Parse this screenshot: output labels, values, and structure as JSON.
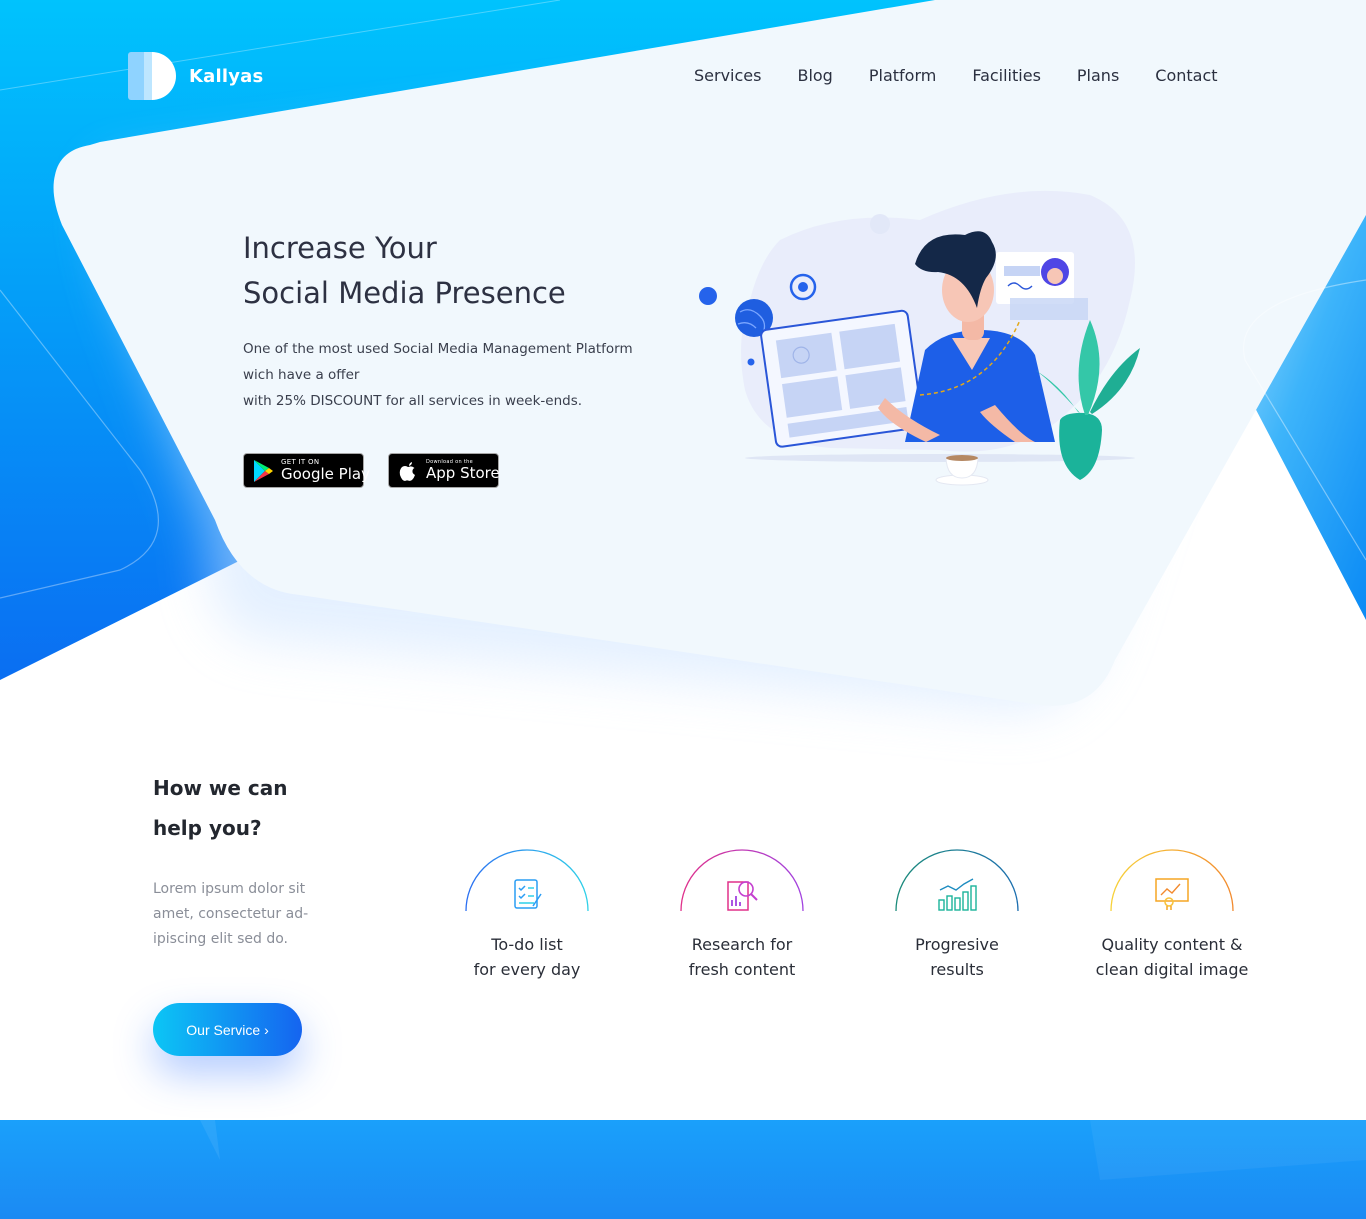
{
  "brand": {
    "name": "Kallyas",
    "logo_icon": "half-circle-logo-icon"
  },
  "nav": {
    "items": [
      "Services",
      "Blog",
      "Platform",
      "Facilities",
      "Plans",
      "Contact"
    ]
  },
  "hero": {
    "title_line1": "Increase Your",
    "title_line2": "Social Media Presence",
    "desc_line1": "One of the most used Social Media Management Platform",
    "desc_line2": "wich have a offer",
    "desc_line3": "with 25% DISCOUNT for all services in week-ends.",
    "google_play": {
      "small": "GET IT ON",
      "big": "Google Play",
      "icon": "google-play-icon"
    },
    "app_store": {
      "small": "Download on the",
      "big": "App Store",
      "icon": "apple-icon"
    }
  },
  "help": {
    "title_line1": "How we can",
    "title_line2": "help you?",
    "desc_line1": "Lorem ipsum dolor sit",
    "desc_line2": "amet, consectetur ad-",
    "desc_line3": "ipiscing elit sed do.",
    "cta_label": "Our Service ›"
  },
  "features": [
    {
      "line1": "To-do list",
      "line2": "for every day",
      "icon": "checklist-icon",
      "color": "#2a9df4"
    },
    {
      "line1": "Research for",
      "line2": "fresh content",
      "icon": "research-icon",
      "color": "#c43fcf"
    },
    {
      "line1": "Progresive",
      "line2": "results",
      "icon": "bar-chart-icon",
      "color": "#1bb39a"
    },
    {
      "line1": "Quality content &",
      "line2": "clean digital image",
      "icon": "presentation-icon",
      "color": "#f5a623"
    }
  ],
  "colors": {
    "primary_blue": "#0a84ff",
    "light_blue": "#00c6ff",
    "card_bg": "#f1f8fd",
    "text_dark": "#2d3142",
    "text_muted": "#8a8e98"
  }
}
